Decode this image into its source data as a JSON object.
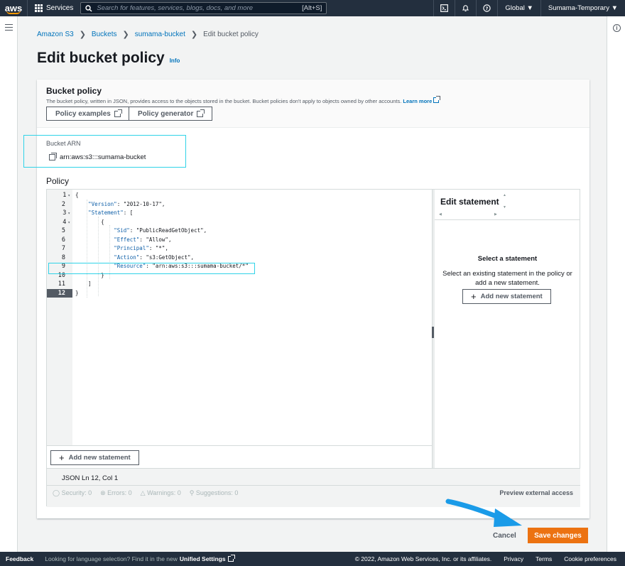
{
  "nav": {
    "logo": "aws",
    "services_label": "Services",
    "search_placeholder": "Search for features, services, blogs, docs, and more",
    "search_shortcut": "[Alt+S]",
    "region": "Global ▼",
    "account": "Sumama-Temporary ▼"
  },
  "breadcrumb": {
    "items": [
      "Amazon S3",
      "Buckets",
      "sumama-bucket"
    ],
    "current": "Edit bucket policy"
  },
  "page": {
    "title": "Edit bucket policy",
    "info_link": "Info"
  },
  "bucket_policy": {
    "heading": "Bucket policy",
    "description": "The bucket policy, written in JSON, provides access to the objects stored in the bucket. Bucket policies don't apply to objects owned by other accounts.",
    "learn_more": "Learn more",
    "policy_examples": "Policy examples",
    "policy_generator": "Policy generator"
  },
  "arn": {
    "label": "Bucket ARN",
    "value": "arn:aws:s3:::sumama-bucket"
  },
  "policy": {
    "label": "Policy",
    "line_numbers": [
      "1",
      "2",
      "3",
      "4",
      "5",
      "6",
      "7",
      "8",
      "9",
      "10",
      "11",
      "12"
    ],
    "lines": [
      "{",
      "    \"Version\": \"2012-10-17\",",
      "    \"Statement\": [",
      "        {",
      "            \"Sid\": \"PublicReadGetObject\",",
      "            \"Effect\": \"Allow\",",
      "            \"Principal\": \"*\",",
      "            \"Action\": \"s3:GetObject\",",
      "            \"Resource\": \"arn:aws:s3:::sumama-bucket/*\"",
      "        }",
      "    ]",
      "}"
    ],
    "add_statement": "Add new statement",
    "cursor_position": "JSON   Ln 12, Col 1",
    "security": "Security: 0",
    "errors": "Errors: 0",
    "warnings": "Warnings: 0",
    "suggestions": "Suggestions: 0",
    "preview_access": "Preview external access"
  },
  "edit_statement": {
    "heading": "Edit statement",
    "empty_title": "Select a statement",
    "empty_desc": "Select an existing statement in the policy or add a new statement.",
    "add_statement": "Add new statement"
  },
  "actions": {
    "cancel": "Cancel",
    "save": "Save changes"
  },
  "footer": {
    "feedback": "Feedback",
    "message": "Looking for language selection? Find it in the new",
    "unified_settings": "Unified Settings",
    "copyright": "© 2022, Amazon Web Services, Inc. or its affiliates.",
    "privacy": "Privacy",
    "terms": "Terms",
    "cookies": "Cookie preferences"
  },
  "colors": {
    "nav_bg": "#232f3e",
    "link": "#0073bb",
    "primary_button": "#ec7211",
    "highlight": "#30d3e8",
    "arrow": "#1a9be8"
  }
}
